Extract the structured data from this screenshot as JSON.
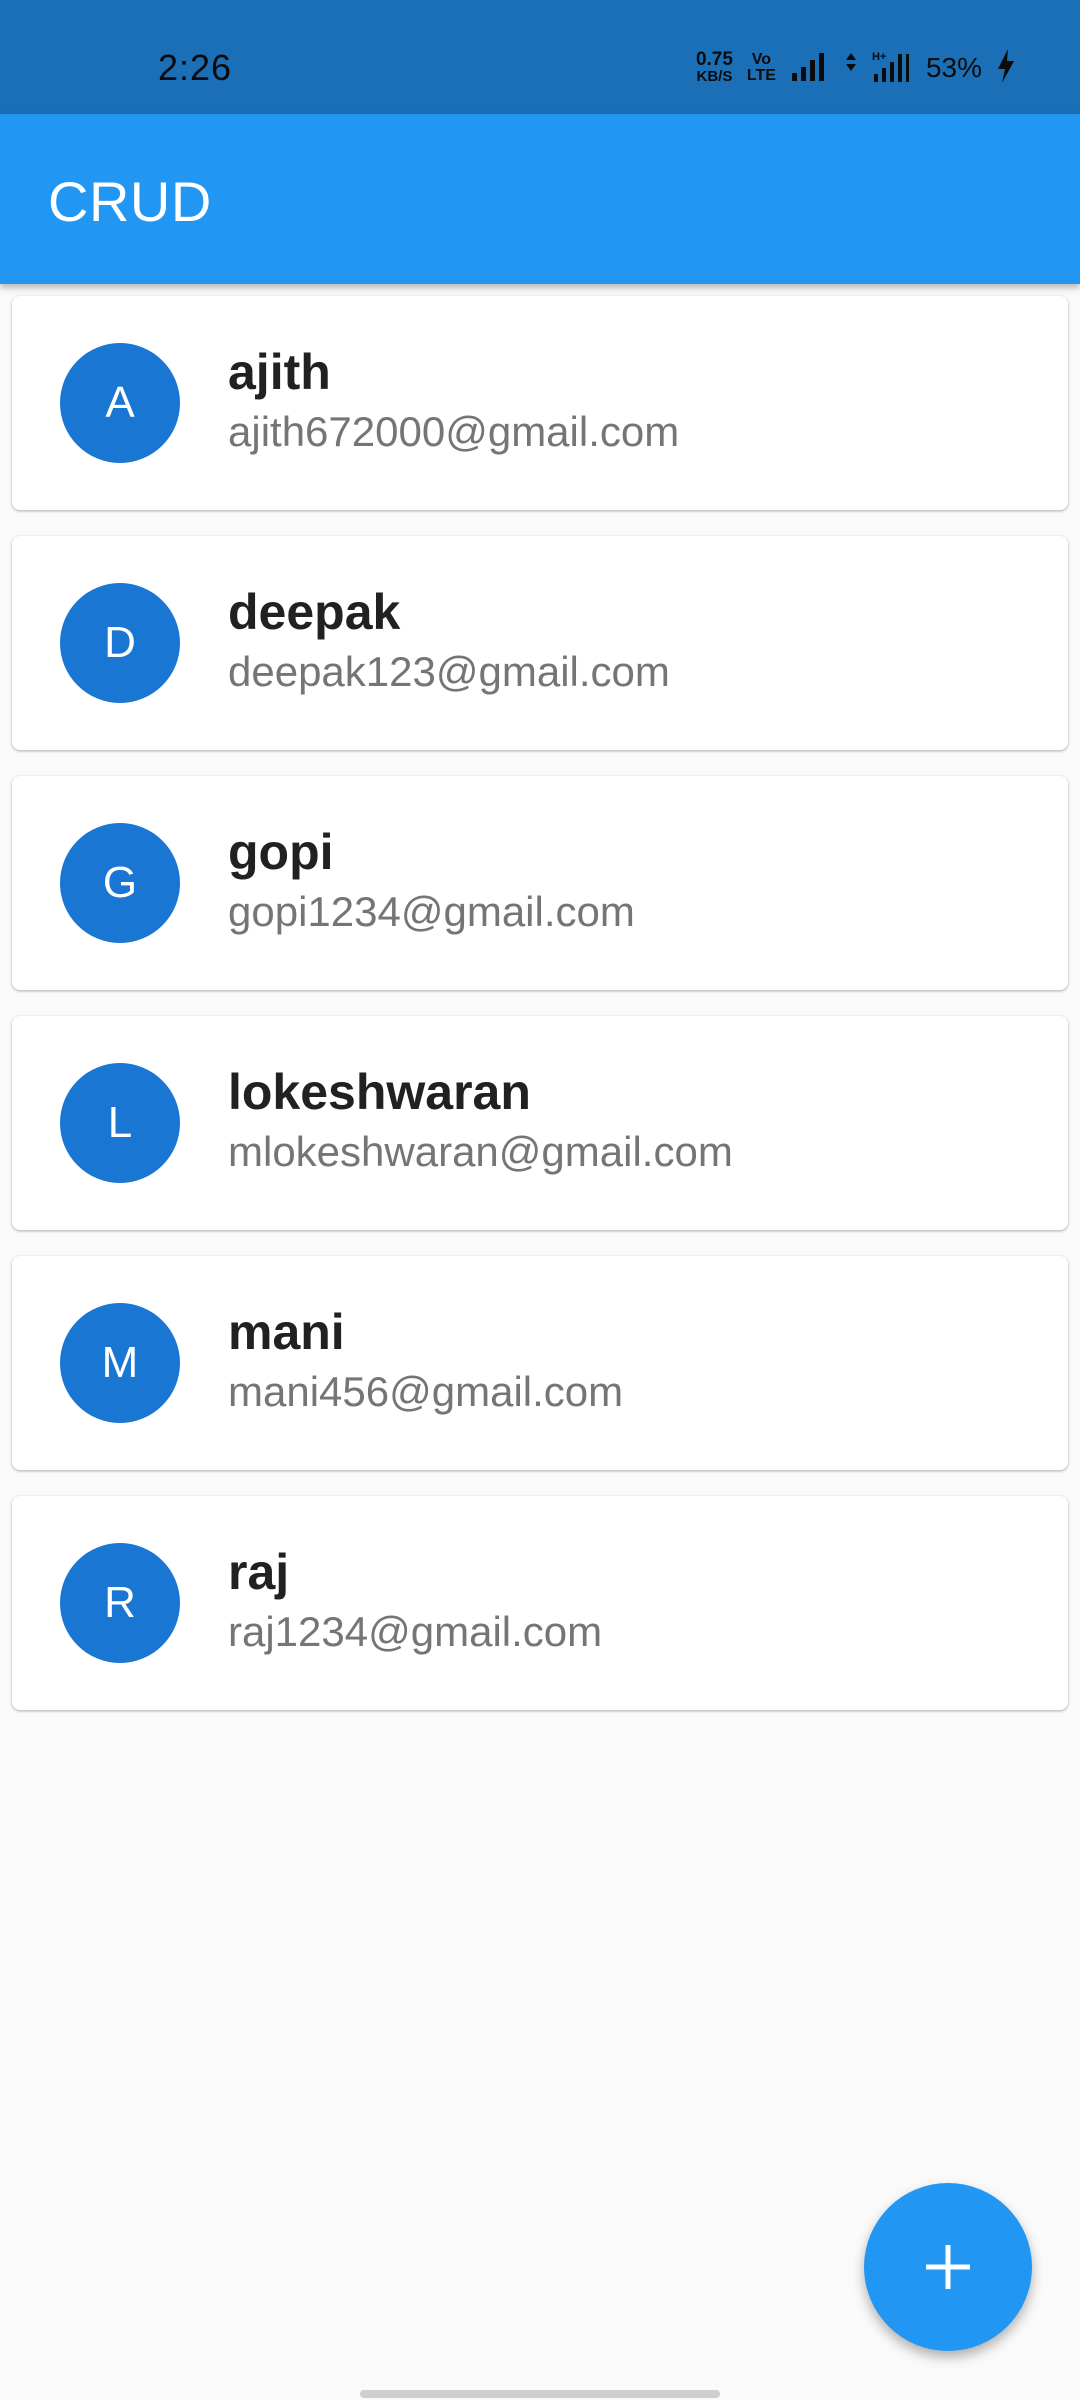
{
  "status_bar": {
    "time": "2:26",
    "net_speed_value": "0.75",
    "net_speed_unit": "KB/S",
    "volte_top": "Vo",
    "volte_bottom": "LTE",
    "battery_percent": "53%",
    "icons": [
      "signal-icon",
      "network-arrows-icon",
      "signal-h-plus-icon",
      "charging-icon"
    ]
  },
  "app_bar": {
    "title": "CRUD"
  },
  "users": [
    {
      "initial": "A",
      "name": "ajith",
      "email": "ajith672000@gmail.com"
    },
    {
      "initial": "D",
      "name": "deepak",
      "email": "deepak123@gmail.com"
    },
    {
      "initial": "G",
      "name": "gopi",
      "email": "gopi1234@gmail.com"
    },
    {
      "initial": "L",
      "name": "lokeshwaran",
      "email": "mlokeshwaran@gmail.com"
    },
    {
      "initial": "M",
      "name": "mani",
      "email": "mani456@gmail.com"
    },
    {
      "initial": "R",
      "name": "raj",
      "email": "raj1234@gmail.com"
    }
  ],
  "fab": {
    "icon": "plus-icon"
  },
  "colors": {
    "status_bar": "#1b6fb7",
    "app_bar": "#2196f3",
    "avatar": "#1976d2",
    "fab": "#2196f3",
    "background": "#fafafa"
  }
}
